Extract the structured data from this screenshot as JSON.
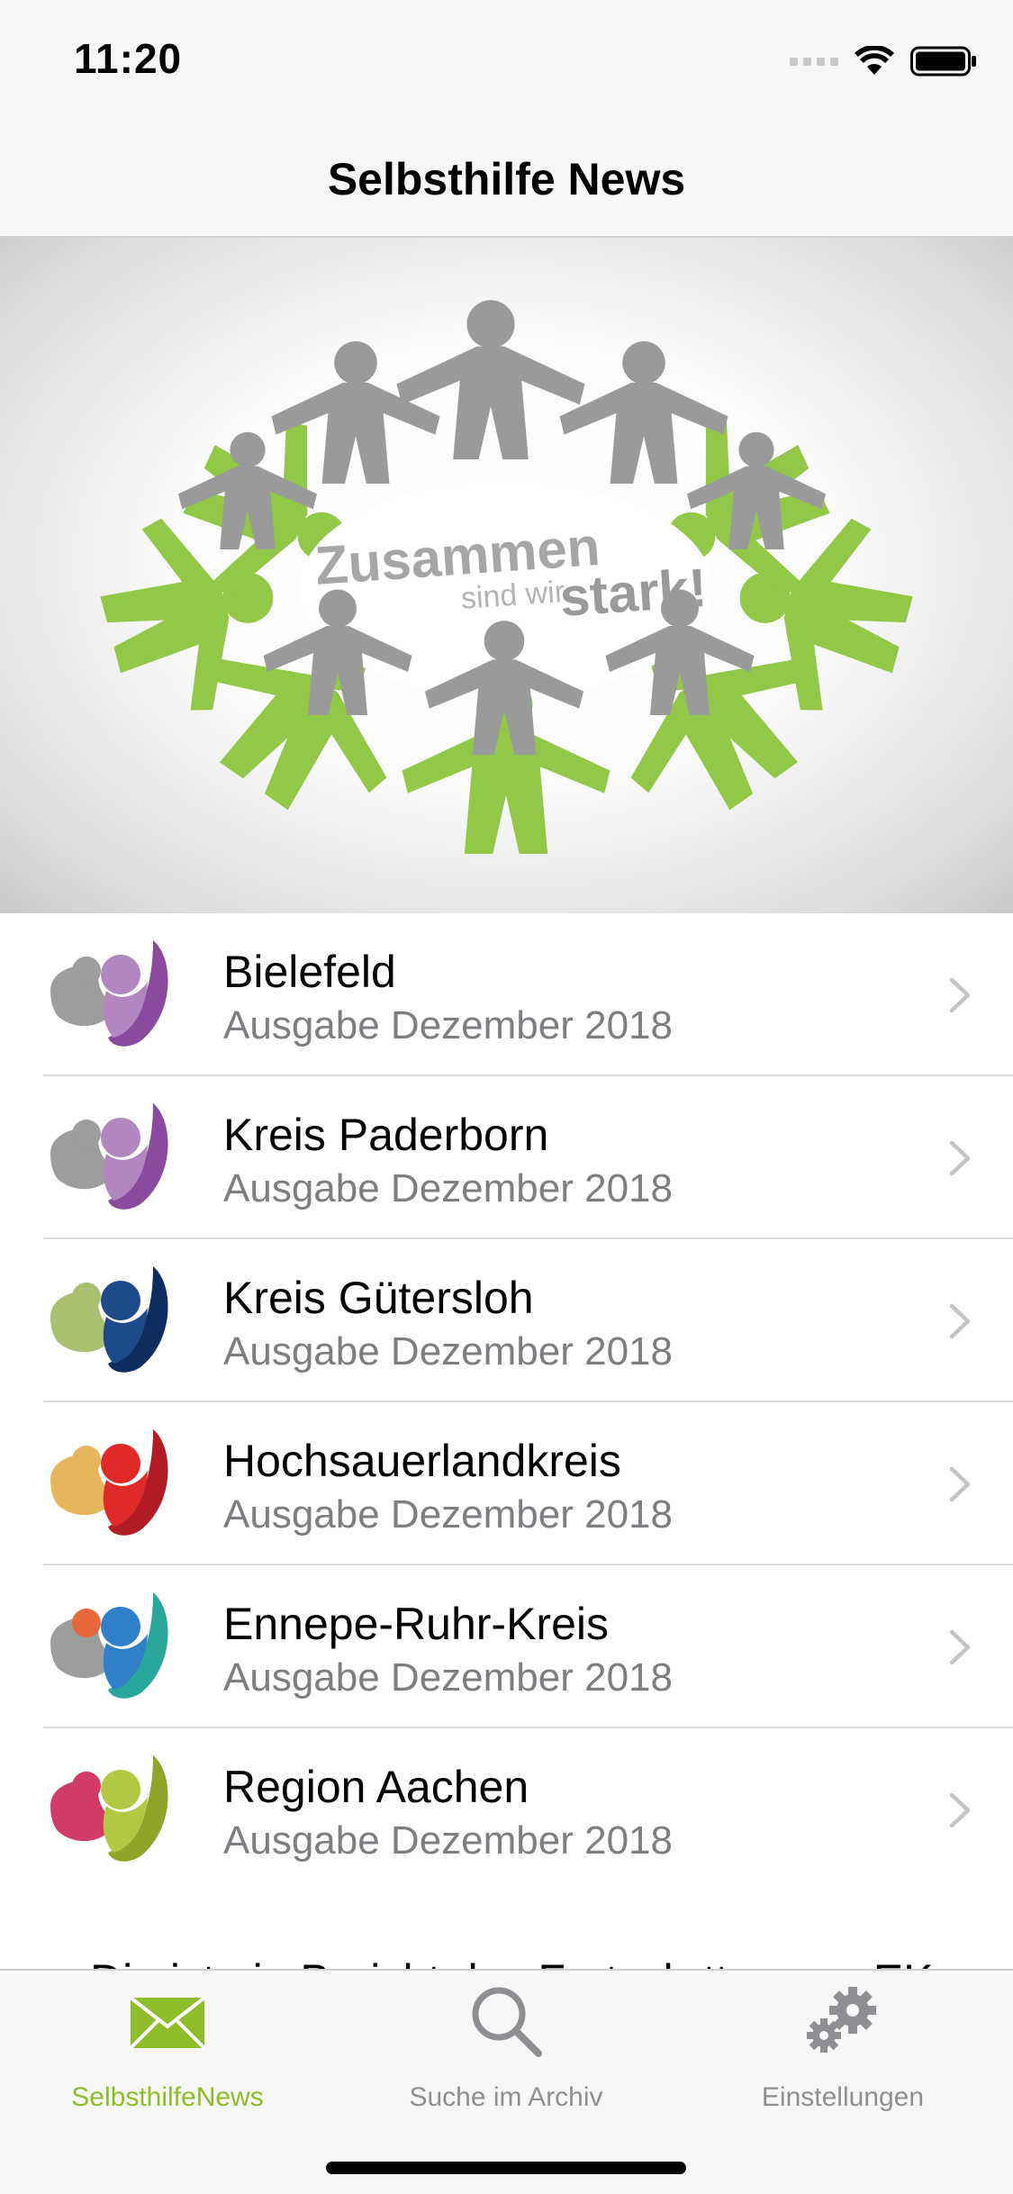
{
  "status": {
    "time": "11:20",
    "icons": [
      "cellular-signal-icon",
      "wifi-icon",
      "battery-icon"
    ]
  },
  "nav": {
    "title": "Selbsthilfe News"
  },
  "hero": {
    "text_line1": "Zusammen",
    "text_line2a": "sind wir",
    "text_line2b": "stark!"
  },
  "list": {
    "items": [
      {
        "title": "Bielefeld",
        "subtitle": "Ausgabe Dezember 2018",
        "colors": [
          "#9d9d9d",
          "#b287c1",
          "#8a4a9e"
        ]
      },
      {
        "title": "Kreis Paderborn",
        "subtitle": "Ausgabe Dezember 2018",
        "colors": [
          "#9d9d9d",
          "#b287c1",
          "#8a4a9e"
        ]
      },
      {
        "title": "Kreis Gütersloh",
        "subtitle": "Ausgabe Dezember 2018",
        "colors": [
          "#a8c070",
          "#1e4a8a",
          "#0c2d5e"
        ]
      },
      {
        "title": "Hochsauerlandkreis",
        "subtitle": "Ausgabe Dezember 2018",
        "colors": [
          "#e8b65a",
          "#e02a2a",
          "#b21c24"
        ]
      },
      {
        "title": "Ennepe-Ruhr-Kreis",
        "subtitle": "Ausgabe Dezember 2018",
        "colors": [
          "#9d9d9d",
          "#2f80c8",
          "#2aa79b"
        ]
      },
      {
        "title": "Region Aachen",
        "subtitle": "Ausgabe Dezember 2018",
        "colors": [
          "#d23a6a",
          "#b2c842",
          "#8ea52a"
        ]
      }
    ],
    "clipped_text": "Die ist ein Bericht des Fortschrttes von EK"
  },
  "tabbar": {
    "tabs": [
      {
        "label": "SelbsthilfeNews",
        "icon": "envelope-icon",
        "active": true
      },
      {
        "label": "Suche im Archiv",
        "icon": "magnifier-icon",
        "active": false
      },
      {
        "label": "Einstellungen",
        "icon": "gears-icon",
        "active": false
      }
    ],
    "active_color": "#8ebd2a",
    "inactive_color": "#8e8e93"
  }
}
